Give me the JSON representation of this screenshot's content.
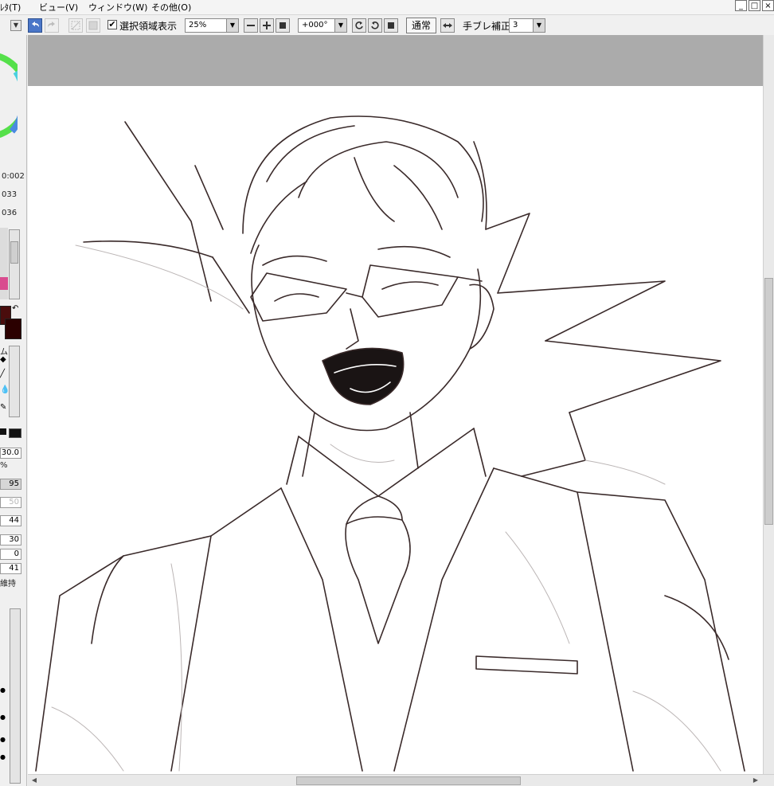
{
  "menu": {
    "items": [
      "ﾚﾀ(T)",
      "ビュー(V)",
      "ウィンドウ(W)",
      "その他(O)"
    ]
  },
  "window_controls": {
    "minimize": "_",
    "restore": "□",
    "close": "×"
  },
  "toolbar": {
    "show_selection_checked": "✔",
    "show_selection_label": "選択領域表示",
    "zoom_value": "25%",
    "rotation_value": "+000°",
    "blend_mode_button": "通常",
    "stabilizer_label": "手ブレ補正",
    "stabilizer_value": "3"
  },
  "left_panel": {
    "values_top": [
      "0:002",
      "033",
      "036"
    ],
    "tool_label_fragment": "ム",
    "size_value": "30.0",
    "percent_symbol": "%",
    "slider_values": [
      "95",
      "50",
      "44",
      "30",
      "0",
      "41"
    ],
    "keep_label": "維持"
  },
  "colors": {
    "primary": "#4a0d0d",
    "secondary": "#2b0000",
    "accent_pink": "#d94b8f",
    "canvas_bg": "#ababab",
    "line_color": "#3a2a2a"
  },
  "icons": {
    "undo": "undo-icon",
    "redo": "redo-icon",
    "deselect": "deselect-icon",
    "invert": "invert-icon",
    "zoom_out": "minus-icon",
    "zoom_in": "plus-icon",
    "zoom_reset": "square-icon",
    "rotate_ccw": "rotate-ccw-icon",
    "rotate_cw": "rotate-cw-icon",
    "rotate_reset": "square-icon",
    "flip": "flip-horizontal-icon"
  }
}
